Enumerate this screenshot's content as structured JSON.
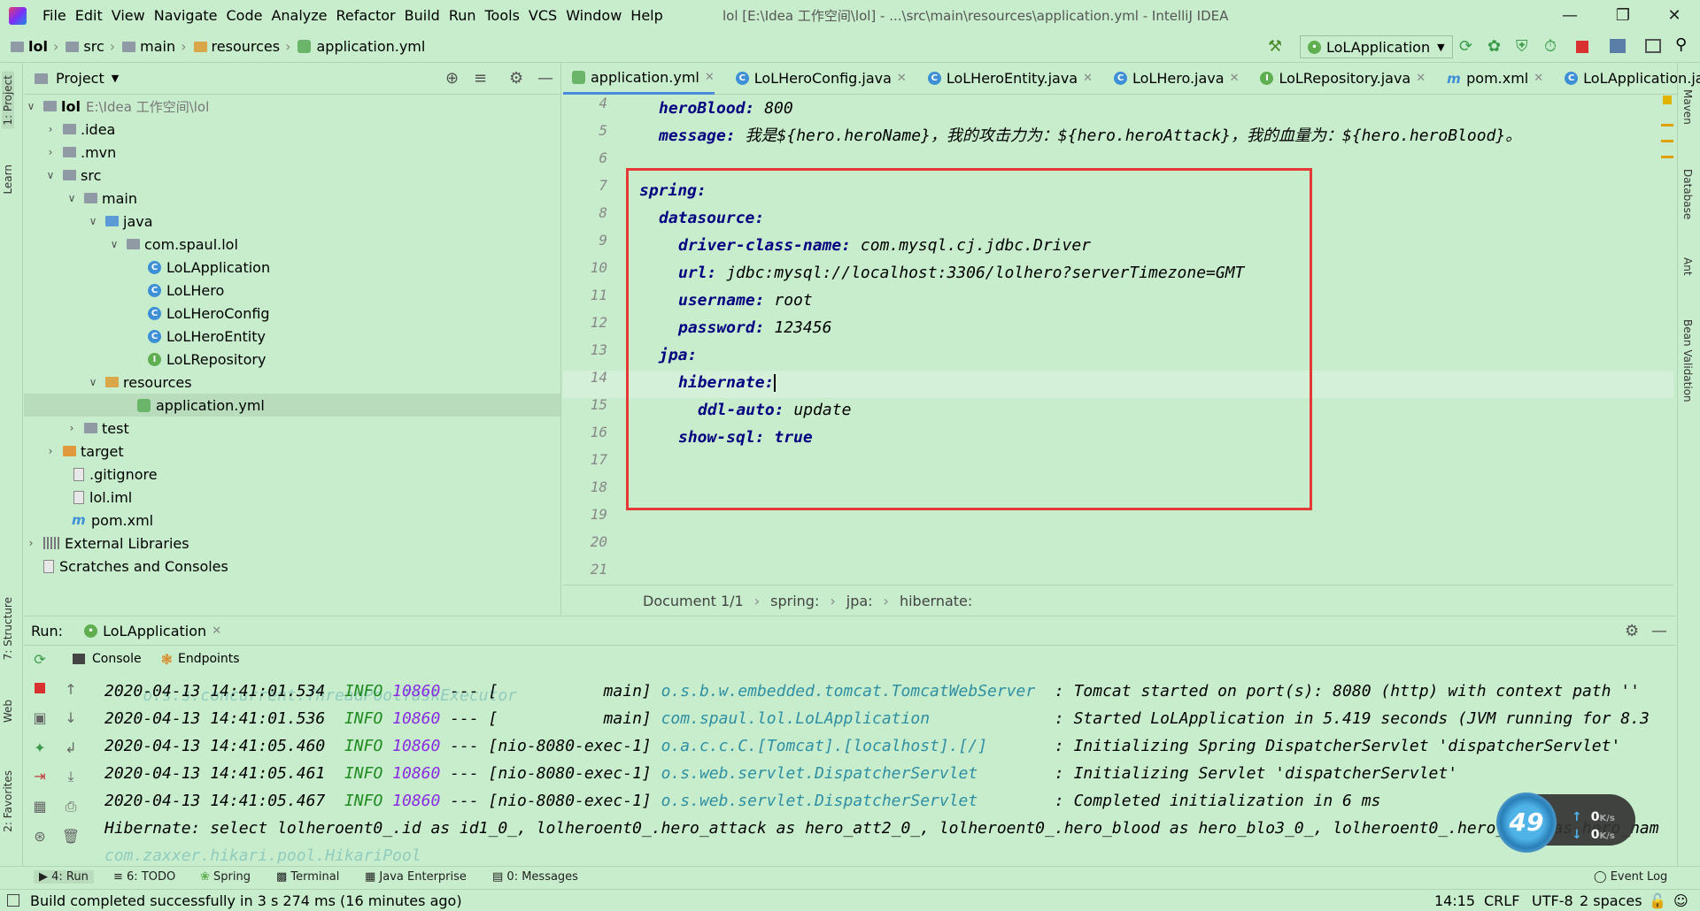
{
  "titlebar": {
    "menu": [
      "File",
      "Edit",
      "View",
      "Navigate",
      "Code",
      "Analyze",
      "Refactor",
      "Build",
      "Run",
      "Tools",
      "VCS",
      "Window",
      "Help"
    ],
    "window_title": "lol [E:\\Idea 工作空间\\lol] - ...\\src\\main\\resources\\application.yml - IntelliJ IDEA"
  },
  "navbar": {
    "crumbs": [
      "lol",
      "src",
      "main",
      "resources",
      "application.yml"
    ],
    "run_config": "LoLApplication"
  },
  "project": {
    "title": "Project",
    "tree": [
      {
        "label": "lol",
        "extra": "E:\\Idea 工作空间\\lol"
      },
      {
        "label": ".idea"
      },
      {
        "label": ".mvn"
      },
      {
        "label": "src"
      },
      {
        "label": "main"
      },
      {
        "label": "java"
      },
      {
        "label": "com.spaul.lol"
      },
      {
        "label": "LoLApplication"
      },
      {
        "label": "LoLHero"
      },
      {
        "label": "LoLHeroConfig"
      },
      {
        "label": "LoLHeroEntity"
      },
      {
        "label": "LoLRepository"
      },
      {
        "label": "resources"
      },
      {
        "label": "application.yml"
      },
      {
        "label": "test"
      },
      {
        "label": "target"
      },
      {
        "label": ".gitignore"
      },
      {
        "label": "lol.iml"
      },
      {
        "label": "pom.xml"
      },
      {
        "label": "External Libraries"
      },
      {
        "label": "Scratches and Consoles"
      }
    ]
  },
  "editor": {
    "tabs": [
      "application.yml",
      "LoLHeroConfig.java",
      "LoLHeroEntity.java",
      "LoLHero.java",
      "LoLRepository.java",
      "pom.xml",
      "LoLApplication.java"
    ],
    "line_numbers": [
      "4",
      "5",
      "6",
      "7",
      "8",
      "9",
      "10",
      "11",
      "12",
      "13",
      "14",
      "15",
      "16",
      "17",
      "18",
      "19",
      "20",
      "21"
    ],
    "lines": [
      {
        "key": "heroBlood:",
        "val": " 800"
      },
      {
        "key": "message:",
        "val": " 我是${hero.heroName}，我的攻击力为：${hero.heroAttack}，我的血量为：${hero.heroBlood}。"
      },
      {
        "key": "",
        "val": ""
      },
      {
        "key": "spring:",
        "val": ""
      },
      {
        "key": "datasource:",
        "val": ""
      },
      {
        "key": "driver-class-name:",
        "val": " com.mysql.cj.jdbc.Driver"
      },
      {
        "key": "url:",
        "val": " jdbc:mysql://localhost:3306/lolhero?serverTimezone=GMT"
      },
      {
        "key": "username:",
        "val": " root"
      },
      {
        "key": "password:",
        "val": " 123456"
      },
      {
        "key": "jpa:",
        "val": ""
      },
      {
        "key": "hibernate:",
        "val": ""
      },
      {
        "key": "ddl-auto:",
        "val": " update"
      },
      {
        "key": "show-sql:",
        "val": " true"
      }
    ],
    "breadcrumb": [
      "Document 1/1",
      "spring:",
      "jpa:",
      "hibernate:"
    ]
  },
  "right_tabs": [
    "Maven",
    "Database",
    "Ant",
    "Bean Validation"
  ],
  "left_tabs": [
    "1: Project",
    "Learn",
    "7: Structure",
    "Web",
    "2: Favorites"
  ],
  "run": {
    "label": "Run:",
    "config_tab": "LoLApplication",
    "subtabs": [
      "Console",
      "Endpoints"
    ],
    "logs": [
      {
        "ts": "2020-04-13 14:41:01.534",
        "lvl": "INFO",
        "pid": "10860",
        "sep": " --- ",
        "thread": "[           main]",
        "cls": "o.s.b.w.embedded.tomcat.TomcatWebServer ",
        "msg": " : Tomcat started on port(s): 8080 (http) with context path ''"
      },
      {
        "ts": "2020-04-13 14:41:01.536",
        "lvl": "INFO",
        "pid": "10860",
        "sep": " --- ",
        "thread": "[           main]",
        "cls": "com.spaul.lol.LoLApplication            ",
        "msg": " : Started LoLApplication in 5.419 seconds (JVM running for 8.3"
      },
      {
        "ts": "2020-04-13 14:41:05.460",
        "lvl": "INFO",
        "pid": "10860",
        "sep": " --- ",
        "thread": "[nio-8080-exec-1]",
        "cls": "o.a.c.c.C.[Tomcat].[localhost].[/]      ",
        "msg": " : Initializing Spring DispatcherServlet 'dispatcherServlet'"
      },
      {
        "ts": "2020-04-13 14:41:05.461",
        "lvl": "INFO",
        "pid": "10860",
        "sep": " --- ",
        "thread": "[nio-8080-exec-1]",
        "cls": "o.s.web.servlet.DispatcherServlet       ",
        "msg": " : Initializing Servlet 'dispatcherServlet'"
      },
      {
        "ts": "2020-04-13 14:41:05.467",
        "lvl": "INFO",
        "pid": "10860",
        "sep": " --- ",
        "thread": "[nio-8080-exec-1]",
        "cls": "o.s.web.servlet.DispatcherServlet       ",
        "msg": " : Completed initialization in 6 ms"
      }
    ],
    "hibernate_line": "Hibernate: select lolheroent0_.id as id1_0_, lolheroent0_.hero_attack as hero_att2_0_, lolheroent0_.hero_blood as hero_blo3_0_, lolheroent0_.hero_name as hero_nam"
  },
  "bottom_tabs": [
    "4: Run",
    "6: TODO",
    "Spring",
    "Terminal",
    "Java Enterprise",
    "0: Messages"
  ],
  "event_log": "Event Log",
  "status": {
    "message": "Build completed successfully in 3 s 274 ms (16 minutes ago)",
    "position": "14:15",
    "line_sep": "CRLF",
    "encoding": "UTF-8",
    "indent": "2 spaces"
  },
  "net_widget": {
    "value": "49",
    "up": "0",
    "down": "0",
    "unit": "K/s"
  }
}
